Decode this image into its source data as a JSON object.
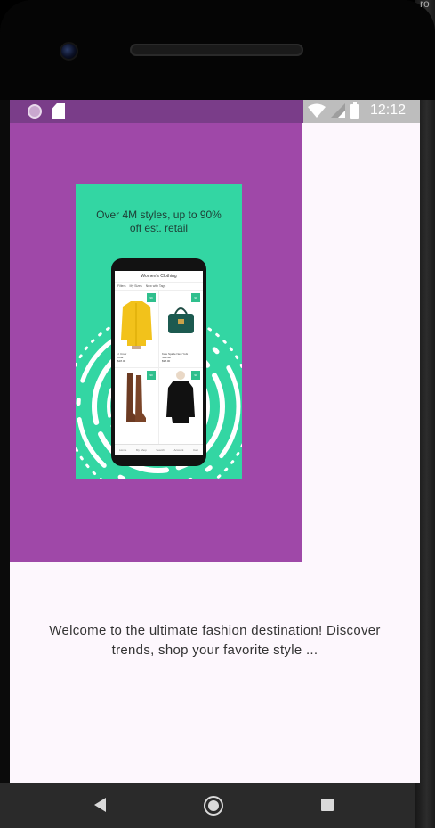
{
  "status_bar": {
    "time": "12:12",
    "icons": [
      "notification-dot-icon",
      "sd-card-icon",
      "wifi-icon",
      "signal-icon",
      "battery-icon"
    ]
  },
  "device": {
    "corner_text": "ro"
  },
  "hero": {
    "background_color": "#9f48a8",
    "promo": {
      "background_color": "#33d6a3",
      "headline": "Over 4M styles, up to 90% off est. retail",
      "mini_app": {
        "title": "Women's Clothing",
        "filters": [
          "Filters",
          "My Sizes",
          "New with Tags"
        ],
        "products": [
          {
            "name": "J. Crew",
            "detail": "Coat",
            "price": "$28.00"
          },
          {
            "name": "Kate Spade New York",
            "detail": "Satchel",
            "price": "$98.00"
          },
          {
            "name": "Boots",
            "detail": "",
            "price": ""
          },
          {
            "name": "Sweater",
            "detail": "",
            "price": ""
          }
        ],
        "nav": [
          "Home",
          "My Shop",
          "Search",
          "Account",
          "Cart"
        ]
      }
    }
  },
  "welcome_text": "Welcome to the ultimate fashion destination! Discover trends, shop your favorite style ...",
  "nav_bar": {
    "icons": [
      "back-icon",
      "home-icon",
      "recent-apps-icon"
    ]
  }
}
